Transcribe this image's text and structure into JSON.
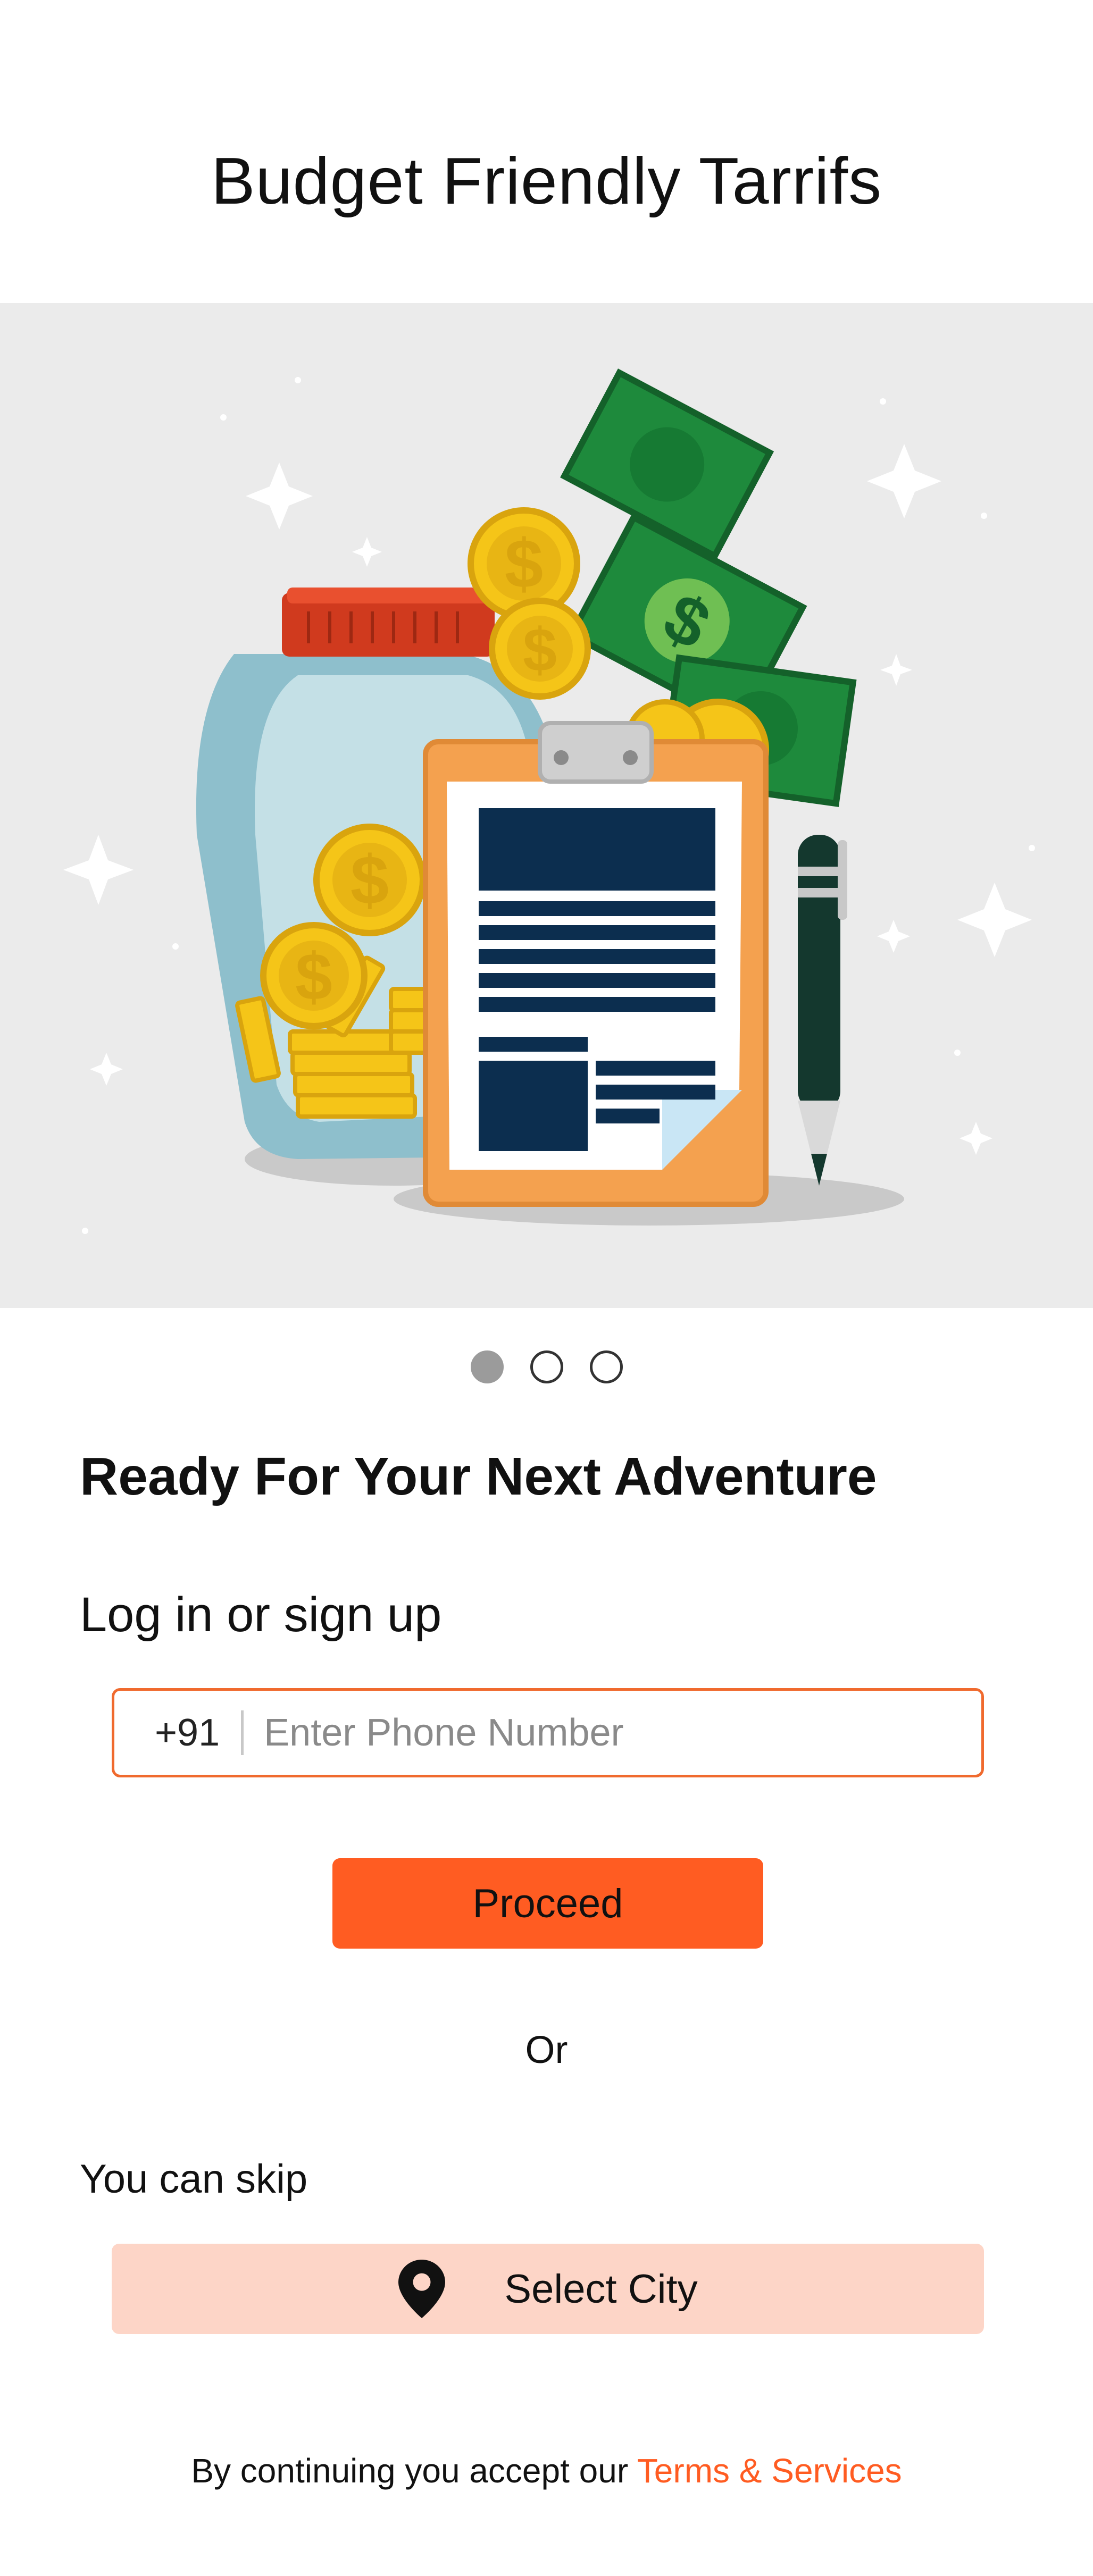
{
  "header": {
    "title": "Budget Friendly Tarrifs"
  },
  "hero": {
    "illustration": "money-jar-clipboard-illustration",
    "carousel": {
      "count": 3,
      "active_index": 0
    }
  },
  "login": {
    "headline": "Ready For Your Next Adventure",
    "subheading": "Log in or sign up",
    "country_code": "+91",
    "phone_placeholder": "Enter Phone Number",
    "proceed_label": "Proceed",
    "or_label": "Or"
  },
  "skip": {
    "label": "You can skip",
    "select_city_label": "Select City",
    "icon": "location-pin-icon"
  },
  "footer": {
    "prefix": "By continuing you accept our",
    "terms_label": "Terms & Services"
  },
  "colors": {
    "accent": "#ff5c22",
    "accent_light": "#fdd5c7",
    "input_border": "#f06a2e",
    "hero_bg": "#ebebeb"
  }
}
